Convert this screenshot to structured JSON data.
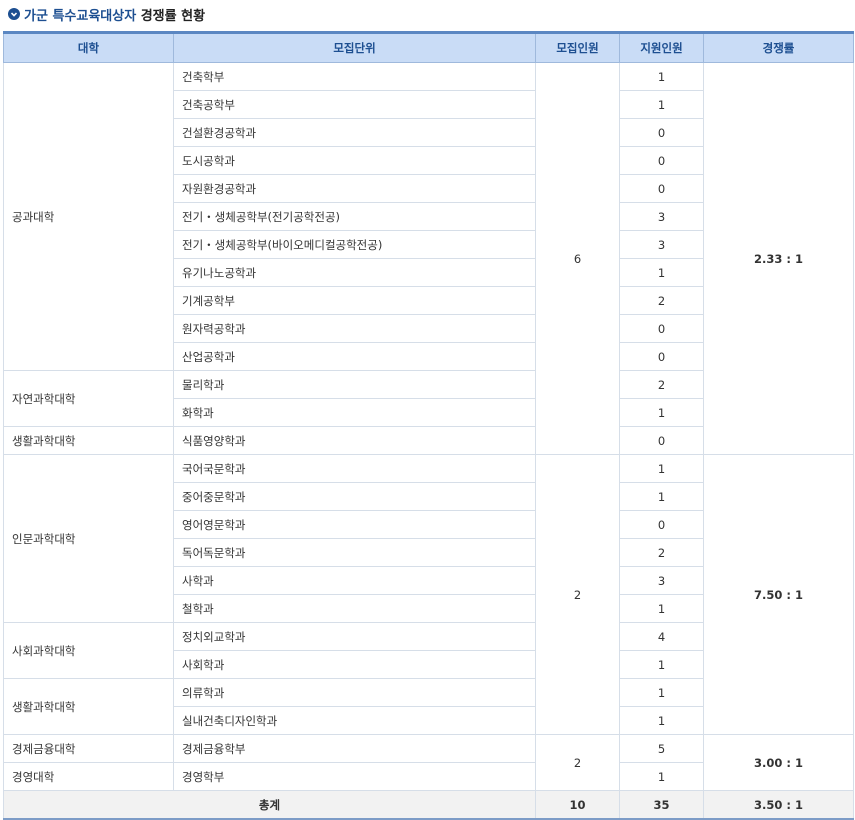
{
  "page": {
    "title_group": "가군 특수교육대상자",
    "title_rest": "경쟁률 현황"
  },
  "table": {
    "headers": [
      "대학",
      "모집단위",
      "모집인원",
      "지원인원",
      "경쟁률"
    ],
    "rows": [
      {
        "college": "공과대학",
        "unit": "건축학부",
        "applicants": "1"
      },
      {
        "college": "",
        "unit": "건축공학부",
        "applicants": "1"
      },
      {
        "college": "",
        "unit": "건설환경공학과",
        "applicants": "0"
      },
      {
        "college": "",
        "unit": "도시공학과",
        "applicants": "0"
      },
      {
        "college": "",
        "unit": "자원환경공학과",
        "applicants": "0"
      },
      {
        "college": "",
        "unit": "전기・생체공학부(전기공학전공)",
        "applicants": "3"
      },
      {
        "college": "",
        "unit": "전기・생체공학부(바이오메디컬공학전공)",
        "applicants": "3"
      },
      {
        "college": "",
        "unit": "유기나노공학과",
        "applicants": "1"
      },
      {
        "college": "",
        "unit": "기계공학부",
        "applicants": "2"
      },
      {
        "college": "",
        "unit": "원자력공학과",
        "applicants": "0"
      },
      {
        "college": "",
        "unit": "산업공학과",
        "applicants": "0"
      },
      {
        "college": "자연과학대학",
        "unit": "물리학과",
        "applicants": "2"
      },
      {
        "college": "",
        "unit": "화학과",
        "applicants": "1"
      },
      {
        "college": "생활과학대학",
        "unit": "식품영양학과",
        "applicants": "0"
      },
      {
        "college": "인문과학대학",
        "unit": "국어국문학과",
        "applicants": "1"
      },
      {
        "college": "",
        "unit": "중어중문학과",
        "applicants": "1"
      },
      {
        "college": "",
        "unit": "영어영문학과",
        "applicants": "0"
      },
      {
        "college": "",
        "unit": "독어독문학과",
        "applicants": "2"
      },
      {
        "college": "",
        "unit": "사학과",
        "applicants": "3"
      },
      {
        "college": "",
        "unit": "철학과",
        "applicants": "1"
      },
      {
        "college": "사회과학대학",
        "unit": "정치외교학과",
        "applicants": "4"
      },
      {
        "college": "",
        "unit": "사회학과",
        "applicants": "1"
      },
      {
        "college": "생활과학대학",
        "unit": "의류학과",
        "applicants": "1"
      },
      {
        "college": "",
        "unit": "실내건축디자인학과",
        "applicants": "1"
      },
      {
        "college": "경제금융대학",
        "unit": "경제금융학부",
        "applicants": "5"
      },
      {
        "college": "경영대학",
        "unit": "경영학부",
        "applicants": "1"
      }
    ],
    "groups": [
      {
        "quota": "6",
        "ratio": "2.33 : 1"
      },
      {
        "quota": "2",
        "ratio": "7.50 : 1"
      },
      {
        "quota": "2",
        "ratio": "3.00 : 1"
      }
    ],
    "total": {
      "label": "총계",
      "quota": "10",
      "applicants": "35",
      "ratio": "3.50 : 1"
    }
  }
}
